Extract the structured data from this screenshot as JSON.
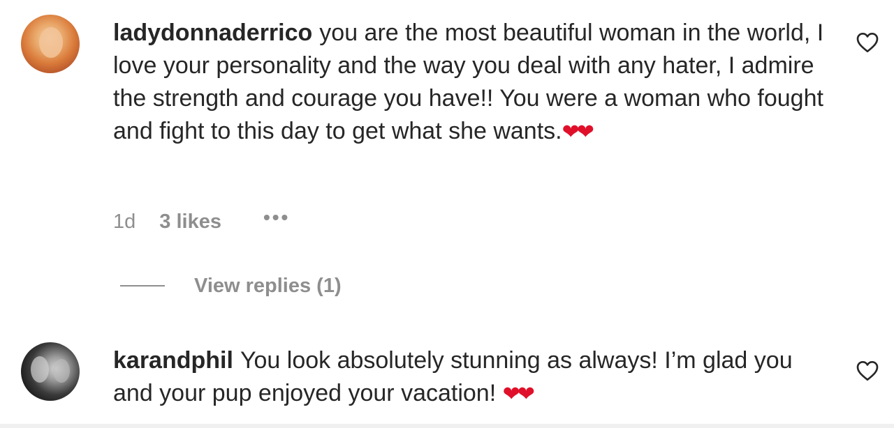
{
  "comments": [
    {
      "username": "ladydonnaderrico",
      "text": "you are the most beautiful woman in the world, I love your personality and the way you deal with any hater, I admire the strength and courage you have!! You were a woman who fought and fight to this day to get what she wants.",
      "emoji": "❤❤",
      "time": "1d",
      "likes": "3 likes",
      "more": "•••",
      "view_replies": "View replies (1)"
    },
    {
      "username": "karandphil",
      "text": "You look absolutely stunning as always! I’m glad you and your pup enjoyed your vacation!",
      "emoji": "❤❤"
    }
  ],
  "icons": {
    "like": "heart-outline-icon",
    "more": "more-options-icon"
  },
  "colors": {
    "text": "#262626",
    "secondary": "#8e8e8e",
    "heart_emoji": "#e0102a"
  }
}
